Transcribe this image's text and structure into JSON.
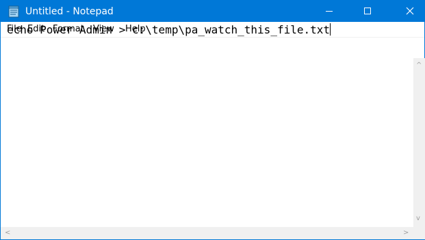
{
  "window": {
    "title": "Untitled - Notepad",
    "accent_color": "#0078d7",
    "icons": {
      "app": "notepad-icon",
      "minimize": "minimize-icon",
      "maximize": "maximize-icon",
      "close": "close-icon"
    }
  },
  "menu": {
    "file": "File",
    "edit": "Edit",
    "format": "Format",
    "view": "View",
    "help": "Help"
  },
  "editor": {
    "content": "echo Power Admin > c:\\temp\\pa_watch_this_file.txt"
  },
  "scrollbars": {
    "up": "^",
    "down": "v",
    "left": "<",
    "right": ">"
  }
}
